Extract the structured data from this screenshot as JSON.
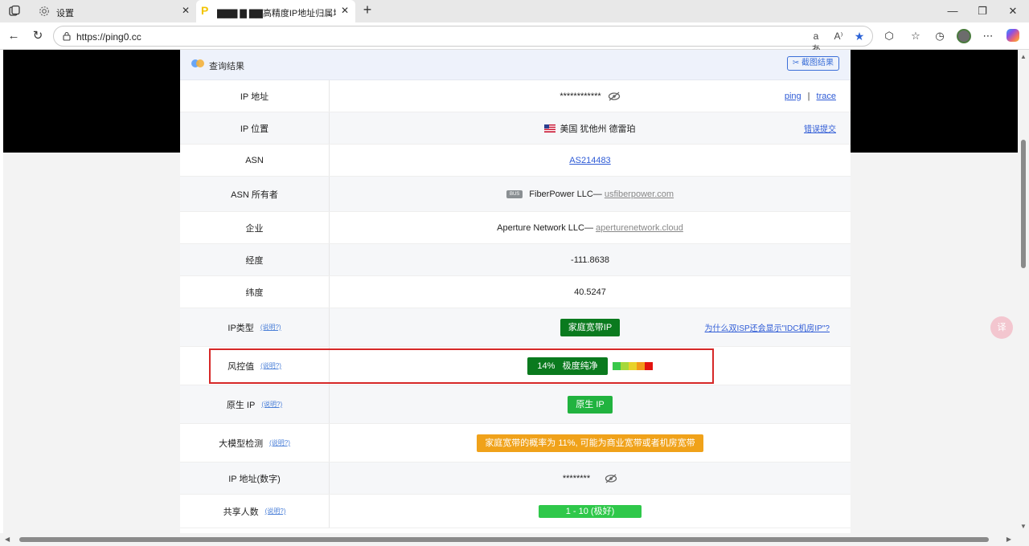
{
  "tabs": [
    {
      "label": "设置"
    },
    {
      "label": "▇▇▇ ▇ ▇▇高精度IP地址归属地"
    }
  ],
  "address_bar": {
    "url": "https://ping0.cc"
  },
  "card": {
    "title": "查询结果",
    "screenshot_button": "✂ 截图结果"
  },
  "rows": {
    "ip": {
      "label": "IP 地址",
      "value": "************",
      "ping": "ping",
      "sep": "|",
      "trace": "trace"
    },
    "location": {
      "label": "IP 位置",
      "value": "美国 犹他州 德雷珀",
      "report": "错误提交"
    },
    "asn": {
      "label": "ASN",
      "value": "AS214483"
    },
    "asn_owner": {
      "label": "ASN 所有者",
      "tag": "BUS",
      "value": "FiberPower LLC— ",
      "domain": "usfiberpower.com"
    },
    "org": {
      "label": "企业",
      "value": "Aperture Network LLC— ",
      "domain": "aperturenetwork.cloud"
    },
    "longitude": {
      "label": "经度",
      "value": "-111.8638"
    },
    "latitude": {
      "label": "纬度",
      "value": "40.5247"
    },
    "ip_type": {
      "label": "IP类型",
      "explain": "(说明?)",
      "value": "家庭宽带IP",
      "question": "为什么双ISP还会显示\"IDC机房IP\"?"
    },
    "risk": {
      "label": "风控值",
      "explain": "(说明?)",
      "value": "14%   极度纯净",
      "level_percent": 14
    },
    "native": {
      "label": "原生 IP",
      "explain": "(说明?)",
      "value": "原生 IP"
    },
    "llm": {
      "label": "大模型检测",
      "explain": "(说明?)",
      "value": "家庭宽带的概率为 11%, 可能为商业宽带或者机房宽带"
    },
    "ip_numeric": {
      "label": "IP 地址(数字)",
      "value": "********"
    },
    "shared": {
      "label": "共享人数",
      "explain": "(说明?)",
      "value": "1 - 10 (极好)"
    }
  },
  "colors": {
    "accent": "#2e5bd6",
    "risk_box": "#d62828",
    "risk_scale": [
      "#39c84a",
      "#a6d83a",
      "#e8d22a",
      "#f29a1a",
      "#e3130f"
    ]
  },
  "float_button": "译"
}
